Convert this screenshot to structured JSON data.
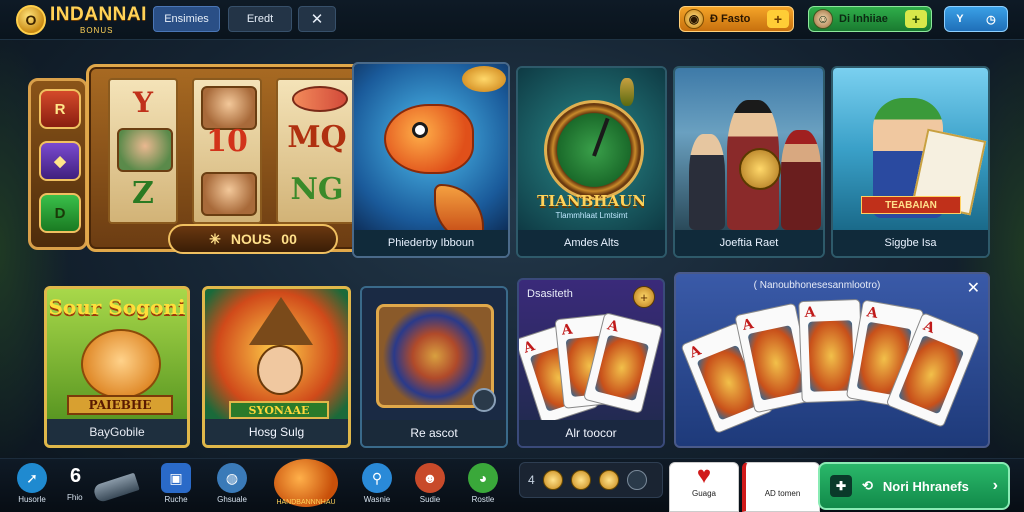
{
  "header": {
    "logo_glyph": "O",
    "brand": "INDANNAI",
    "brand_sub": "BONUS",
    "tabs": [
      {
        "label": "Ensimies",
        "active": true
      },
      {
        "label": "Eredt",
        "active": false
      }
    ],
    "close_label": "✕",
    "coins_pill": {
      "label": "Ð Fasto",
      "icon": "coin-icon",
      "plus": "+"
    },
    "gems_pill": {
      "label": "Di Inhiiae",
      "icon": "face-icon",
      "plus": "+"
    },
    "profile_pill": {
      "left": "Y",
      "right": "◷"
    }
  },
  "slot_machine": {
    "side_buttons": [
      "R",
      "◆",
      "D"
    ],
    "reel_symbols": [
      "Y",
      "Z",
      "10",
      "MQ",
      "NG"
    ],
    "plaque_icon": "✳",
    "plaque_label": "NOUS",
    "plaque_value": "00"
  },
  "feature_cards": [
    {
      "caption": "Phiederby Ibboun",
      "icon": "fish-icon"
    },
    {
      "caption": "Amdes Alts",
      "title": "TIANBHAUN",
      "subtitle": "Tlammhlaat Lmtsimt",
      "icon": "clock-icon"
    },
    {
      "caption": "Joeftia Raet",
      "icon": "dealers-icon"
    },
    {
      "caption": "Siggbe Isa",
      "banner": "TEABAIAN",
      "icon": "island-icon"
    }
  ],
  "game_tiles": [
    {
      "caption": "BayGobile",
      "title": "Sour Sogoni",
      "banner": "PAIEBHE"
    },
    {
      "caption": "Hosg Sulg",
      "banner": "SYONAAE"
    },
    {
      "caption": "Re ascot"
    },
    {
      "caption": "Alr toocor",
      "title": "Dsasiteth",
      "badge": "+"
    }
  ],
  "cards_panel": {
    "title": "( Nanoubhonesesanmlootro)",
    "close": "✕",
    "cards": [
      "A",
      "A",
      "A",
      "A",
      "A"
    ]
  },
  "bottom_nav": [
    {
      "label": "Husorle",
      "icon": "arrow-icon",
      "color": "#1f8ad0"
    },
    {
      "label": "Ruche",
      "icon": "square-icon",
      "color": "#2a6ac8"
    },
    {
      "label": "Ghsuale",
      "icon": "globe-icon",
      "color": "#3a7ab8"
    },
    {
      "label": "Wasnie",
      "icon": "pin-icon",
      "color": "#2a8ad8"
    },
    {
      "label": "Sudie",
      "icon": "face-icon",
      "color": "#c84a2a"
    },
    {
      "label": "Rostle",
      "icon": "alien-icon",
      "color": "#3aa83a"
    }
  ],
  "count": {
    "value": "6",
    "label": "Fhio"
  },
  "pumpkin_label": "HANDBANNNHAU",
  "coin_row": {
    "prefix": "4"
  },
  "bottom_cards": [
    {
      "suit": "♥",
      "label": "Guaga"
    },
    {
      "suit": "✿",
      "label": "AD tomen"
    }
  ],
  "next_button": {
    "label": "Nori Hhranefs",
    "chevron": "›"
  },
  "colors": {
    "accent": "#ffd257",
    "green": "#2ab86a",
    "panel": "#102a3a"
  }
}
